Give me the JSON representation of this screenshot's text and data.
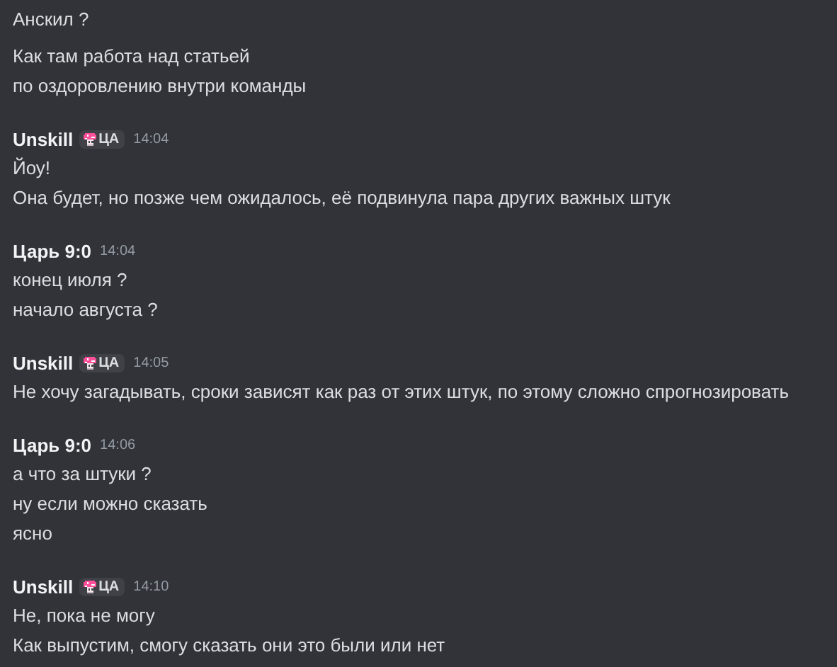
{
  "messages": [
    {
      "lines": [
        "Анскил ?",
        "Как там работа над статьей",
        "по оздоровлению внутри команды"
      ]
    },
    {
      "author": "Unskill",
      "badge": "ЦА",
      "time": "14:04",
      "lines": [
        "Йоу!",
        "Она будет, но позже чем ожидалось, её подвинула пара других важных штук"
      ]
    },
    {
      "author": "Царь 9:0",
      "time": "14:04",
      "lines": [
        "конец июля ?",
        "начало августа ?"
      ]
    },
    {
      "author": "Unskill",
      "badge": "ЦА",
      "time": "14:05",
      "lines": [
        "Не хочу загадывать, сроки зависят как раз от этих штук, по этому сложно спрогнозировать"
      ]
    },
    {
      "author": "Царь 9:0",
      "time": "14:06",
      "lines": [
        "а что за штуки ?",
        "ну если можно сказать",
        "ясно"
      ]
    },
    {
      "author": "Unskill",
      "badge": "ЦА",
      "time": "14:10",
      "lines": [
        "Не, пока не могу",
        "Как выпустим, смогу сказать они это были или нет"
      ]
    }
  ]
}
